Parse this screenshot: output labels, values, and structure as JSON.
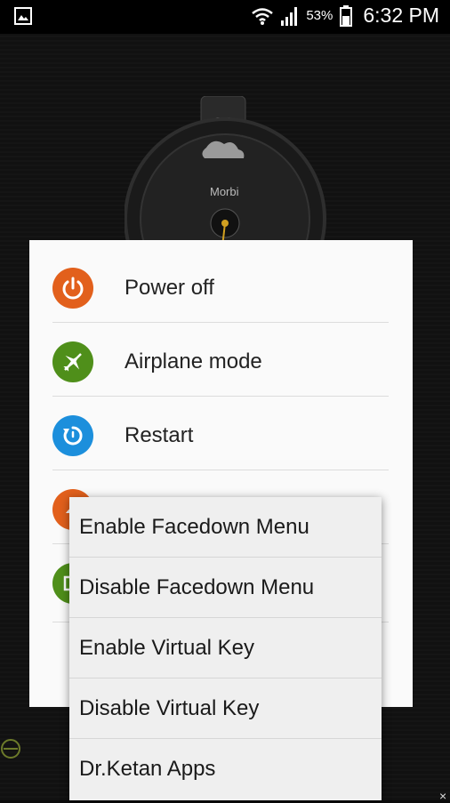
{
  "status_bar": {
    "battery_percent": "53%",
    "time": "6:32 PM",
    "icons": [
      "gallery-icon",
      "wifi-icon",
      "signal-icon",
      "battery-icon"
    ]
  },
  "wallpaper": {
    "widget_label": "Morbi"
  },
  "power_menu": {
    "items": [
      {
        "label": "Power off",
        "icon": "power-icon",
        "color": "#e2601c"
      },
      {
        "label": "Airplane mode",
        "icon": "airplane-icon",
        "color": "#4f8f1a"
      },
      {
        "label": "Restart",
        "icon": "restart-icon",
        "color": "#1c8fdc"
      },
      {
        "label": "",
        "icon": "emergency-icon",
        "color": "#e2601c"
      },
      {
        "label": "",
        "icon": "screenshot-icon",
        "color": "#4f8f1a"
      }
    ]
  },
  "context_menu": {
    "items": [
      {
        "label": "Enable Facedown Menu"
      },
      {
        "label": "Disable Facedown Menu"
      },
      {
        "label": "Enable Virtual Key"
      },
      {
        "label": "Disable Virtual Key"
      },
      {
        "label": "Dr.Ketan Apps"
      }
    ]
  }
}
